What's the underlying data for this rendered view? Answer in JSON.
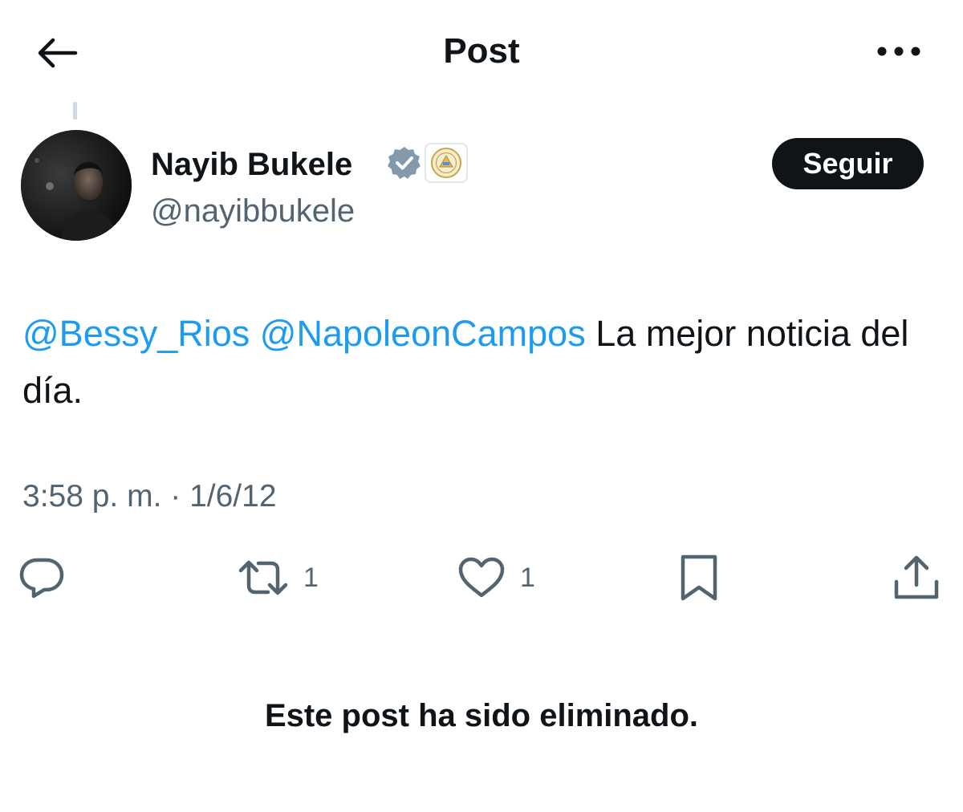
{
  "header": {
    "title": "Post",
    "back_icon": "arrow-left-icon",
    "more_icon": "more-horizontal-icon"
  },
  "author": {
    "name": "Nayib Bukele",
    "handle": "@nayibbukele",
    "verified_icon": "verified-badge-icon",
    "affiliate_icon": "government-seal-icon",
    "follow_label": "Seguir"
  },
  "post": {
    "mentions": [
      "@Bessy_Rios",
      "@NapoleonCampos"
    ],
    "text": "La mejor noticia del día.",
    "timestamp": "3:58 p. m. · 1/6/12"
  },
  "actions": {
    "reply_icon": "reply-icon",
    "retweet_icon": "retweet-icon",
    "retweet_count": "1",
    "like_icon": "heart-icon",
    "like_count": "1",
    "bookmark_icon": "bookmark-icon",
    "share_icon": "share-icon"
  },
  "notice": "Este post ha sido eliminado.",
  "colors": {
    "link": "#1d9bf0",
    "text": "#0f1419",
    "secondary": "#536471",
    "verified": "#829aab",
    "button_bg": "#0f1419"
  }
}
